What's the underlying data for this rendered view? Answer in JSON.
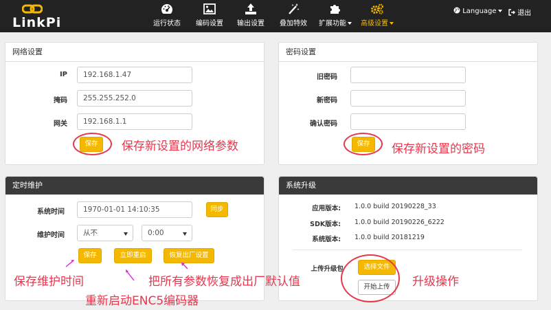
{
  "brand": {
    "logo_text": "LinkPi"
  },
  "nav": {
    "items": [
      {
        "label": "运行状态",
        "icon": "dashboard-icon"
      },
      {
        "label": "编码设置",
        "icon": "image-icon"
      },
      {
        "label": "输出设置",
        "icon": "upload-icon"
      },
      {
        "label": "叠加特效",
        "icon": "magic-wand-icon"
      },
      {
        "label": "扩展功能",
        "icon": "puzzle-icon"
      },
      {
        "label": "高级设置",
        "icon": "gears-icon"
      }
    ],
    "language": "Language",
    "logout": "退出"
  },
  "network": {
    "title": "网络设置",
    "ip_label": "IP",
    "ip_value": "192.168.1.47",
    "mask_label": "掩码",
    "mask_value": "255.255.252.0",
    "gateway_label": "网关",
    "gateway_value": "192.168.1.1",
    "save": "保存"
  },
  "password": {
    "title": "密码设置",
    "old_label": "旧密码",
    "new_label": "新密码",
    "confirm_label": "确认密码",
    "save": "保存"
  },
  "maintenance": {
    "title": "定时维护",
    "time_label": "系统时间",
    "time_value": "1970-01-01 14:10:35",
    "sync": "同步",
    "maint_label": "维护时间",
    "day_value": "从不",
    "hour_value": "0:00",
    "save": "保存",
    "reboot": "立即重启",
    "reset": "恢复出厂设置"
  },
  "upgrade": {
    "title": "系统升级",
    "app_label": "应用版本:",
    "app_value": "1.0.0 build 20190228_33",
    "sdk_label": "SDK版本:",
    "sdk_value": "1.0.0 build 20190226_6222",
    "sys_label": "系统版本:",
    "sys_value": "1.0.0 build 20181219",
    "upload_label": "上传升级包",
    "choose": "选择文件",
    "start": "开始上传"
  },
  "annotations": {
    "net_save": "保存新设置的网络参数",
    "pwd_save": "保存新设置的密码",
    "maint_save": "保存维护时间",
    "reset": "把所有参数恢复成出厂默认值",
    "reboot": "重新启动ENC5编码器",
    "upgrade": "升级操作"
  },
  "colors": {
    "accent": "#f5b800",
    "annotation": "#e8364c",
    "navbar": "#222222"
  }
}
